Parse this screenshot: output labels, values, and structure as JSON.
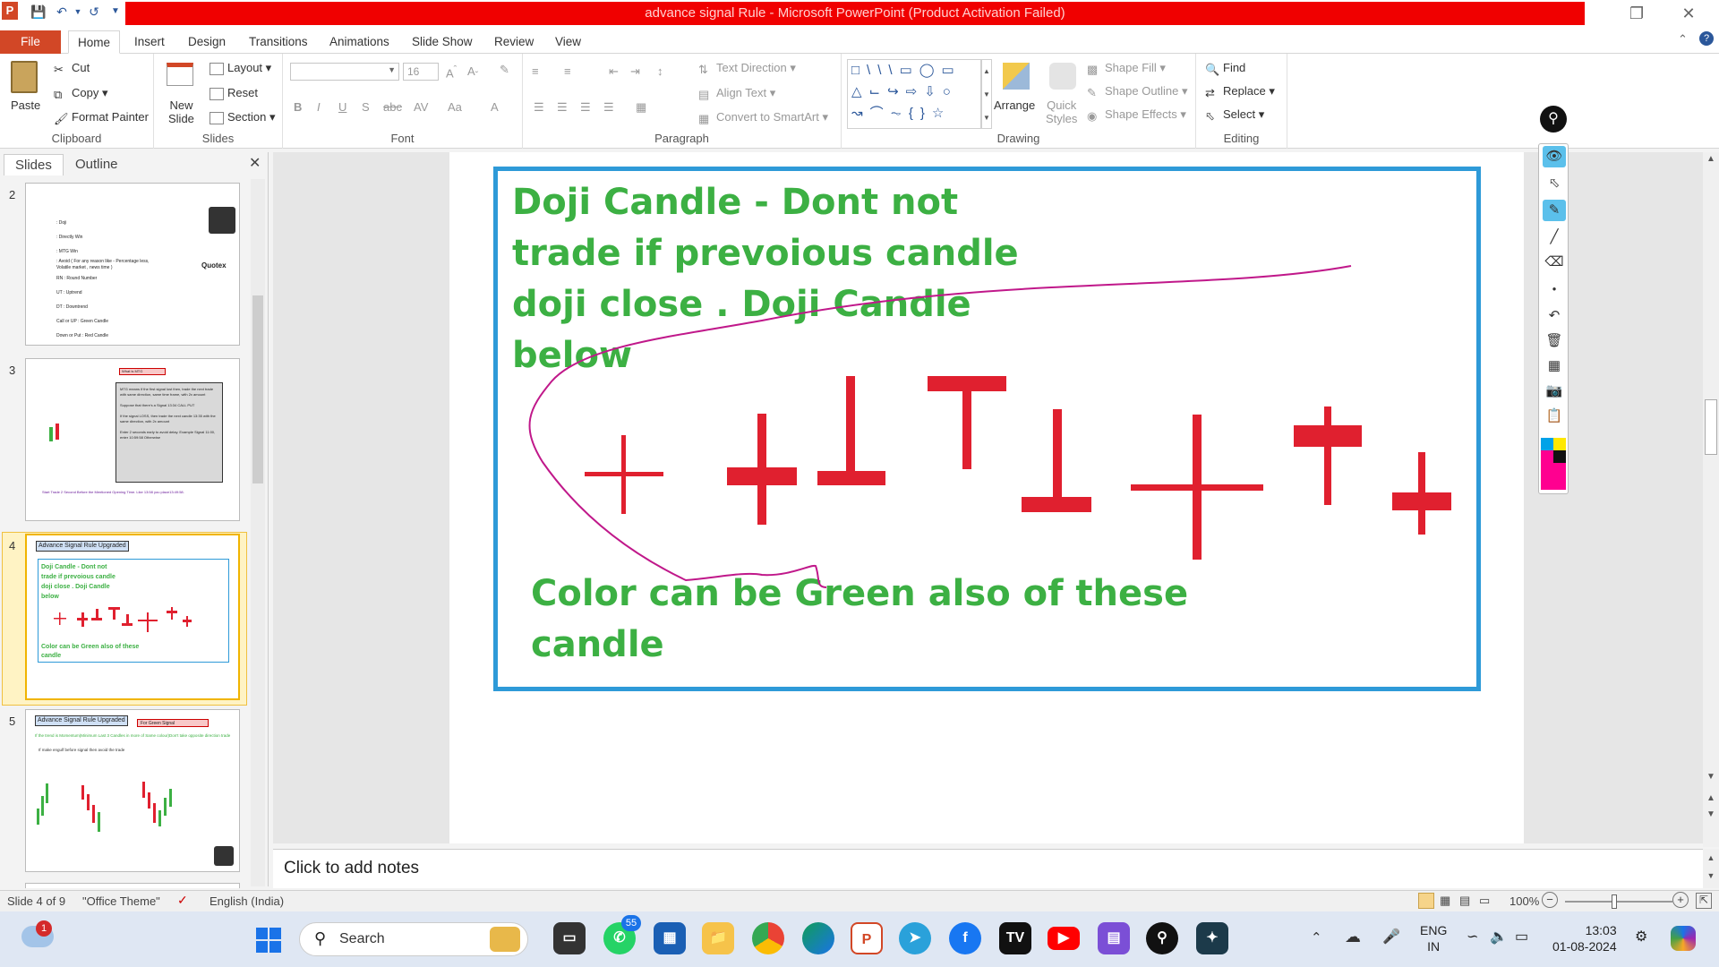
{
  "window": {
    "title": "advance signal Rule  -  Microsoft PowerPoint (Product Activation Failed)"
  },
  "qat": {
    "app_icon": "P"
  },
  "tabs": [
    "File",
    "Home",
    "Insert",
    "Design",
    "Transitions",
    "Animations",
    "Slide Show",
    "Review",
    "View"
  ],
  "ribbon": {
    "clipboard": {
      "paste": "Paste",
      "cut": "Cut",
      "copy": "Copy",
      "format_painter": "Format Painter",
      "label": "Clipboard"
    },
    "slides": {
      "new_slide_1": "New",
      "new_slide_2": "Slide",
      "layout": "Layout",
      "reset": "Reset",
      "section": "Section",
      "label": "Slides"
    },
    "font": {
      "size": "16",
      "label": "Font"
    },
    "paragraph": {
      "text_direction": "Text Direction",
      "align_text": "Align Text",
      "convert": "Convert to SmartArt",
      "label": "Paragraph"
    },
    "drawing": {
      "arrange": "Arrange",
      "quick_styles_1": "Quick",
      "quick_styles_2": "Styles",
      "shape_fill": "Shape Fill",
      "shape_outline": "Shape Outline",
      "shape_effects": "Shape Effects",
      "label": "Drawing"
    },
    "editing": {
      "find": "Find",
      "replace": "Replace",
      "select": "Select",
      "label": "Editing"
    }
  },
  "panel": {
    "tab_slides": "Slides",
    "tab_outline": "Outline",
    "close": "✕",
    "thumbs": [
      {
        "num": "2",
        "lines": [
          ": Doji",
          ": Directly Win",
          ": MTG Win",
          ": Avoid ( For any reason like - Percentage less, Volatile market , news time )",
          "RN : Round Number",
          "UT : Uptrend",
          "DT : Downtrend",
          "Call or UP  : Green Candle",
          "Down or Put  : Red Candle"
        ],
        "brand": "Quotex"
      },
      {
        "num": "3",
        "title": "What is MTG",
        "lines": [
          "MTG means if the first signal lost then, trade the next trade with same direction, same time frame, with 2x amount",
          "Suppose that there's a Signal 13:34 CALL PUT",
          "If the signal LOSS, then trade the next candle 13:35 with the same direction, with 2x amount",
          "Enter 2 seconds early to avoid delay. Example Signal 11:00, enter 10:59:58 Otherwise"
        ],
        "footer": "Start Trade 2 Second Before the Mentioned Opening Time. Like 13:58 you place13:49:58."
      },
      {
        "num": "4",
        "title": "Advance Signal Rule Upgraded",
        "lines": [
          "Doji Candle - Dont not",
          "trade if prevoious candle",
          "doji close . Doji Candle",
          "below"
        ],
        "footer1": "Color can be Green also of these",
        "footer2": "candle"
      },
      {
        "num": "5",
        "title": "Advance Signal Rule Upgraded",
        "tag": "For Green Signal",
        "lines": [
          "If the trend is Momentum(Minimum Last 3 Candles in more of Same colour)Don't take opposite direction trade",
          "If make engulf before signal then avoid the trade"
        ]
      }
    ]
  },
  "slide": {
    "heading": "Doji Candle - Dont not\ntrade if prevoious candle\ndoji close . Doji Candle\nbelow",
    "footer": "Color can be Green also of these\ncandle"
  },
  "notes": {
    "placeholder": "Click to add notes"
  },
  "status": {
    "slide": "Slide 4 of 9",
    "theme": "\"Office Theme\"",
    "language": "English (India)",
    "zoom": "100%"
  },
  "taskbar": {
    "search": "Search",
    "whatsapp_badge": "55",
    "weather_badge": "1",
    "lang1": "ENG",
    "lang2": "IN",
    "time": "13:03",
    "date": "01-08-2024"
  },
  "colors": {
    "accent": "#d24726",
    "title_bar": "#f00000",
    "slide_text": "#3cb043",
    "candle": "#e0202f",
    "frame": "#2e9ad8",
    "pen": "#c0188a"
  }
}
